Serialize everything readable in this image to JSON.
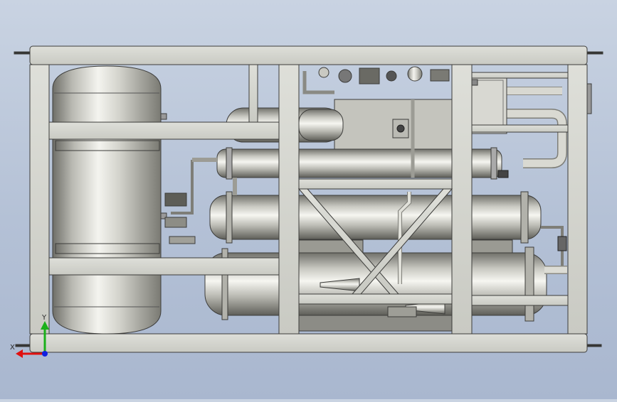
{
  "viewport": {
    "background_top": "#c9d3e2",
    "background_bottom": "#a9b7cf"
  },
  "model": {
    "frame_color": "#d6d7d0",
    "edge_color": "#3c3c3a",
    "vessel_color": "#bdbdb6"
  },
  "triad": {
    "x_label": "X",
    "y_label": "Y",
    "x_color": "#e01010",
    "y_color": "#1ab01a",
    "z_color": "#1020e0"
  }
}
